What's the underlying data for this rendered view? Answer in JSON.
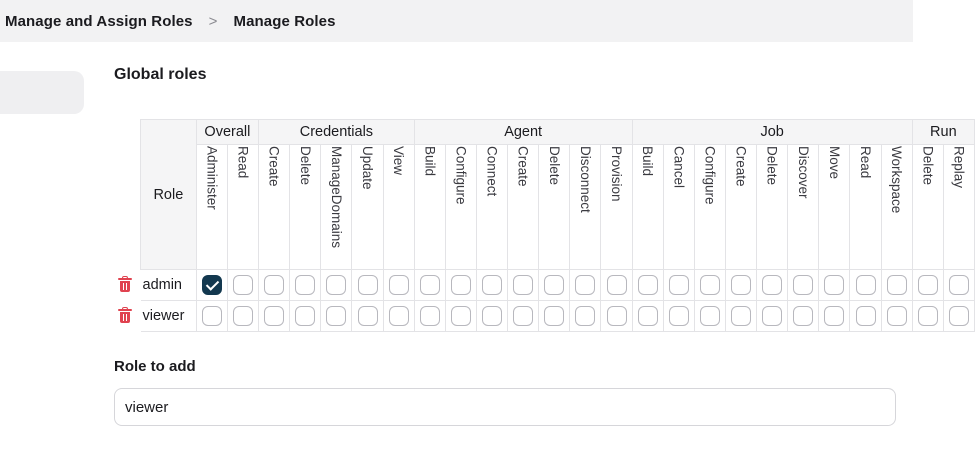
{
  "breadcrumb": {
    "items": [
      "Manage and Assign Roles",
      "Manage Roles"
    ],
    "separator": ">"
  },
  "global_roles": {
    "title": "Global roles",
    "role_header": "Role",
    "groups": [
      {
        "label": "Overall",
        "span": 2
      },
      {
        "label": "Credentials",
        "span": 5
      },
      {
        "label": "Agent",
        "span": 7
      },
      {
        "label": "Job",
        "span": 9
      },
      {
        "label": "Run",
        "span": 2
      }
    ],
    "permissions": [
      "Administer",
      "Read",
      "Create",
      "Delete",
      "ManageDomains",
      "Update",
      "View",
      "Build",
      "Configure",
      "Connect",
      "Create",
      "Delete",
      "Disconnect",
      "Provision",
      "Build",
      "Cancel",
      "Configure",
      "Create",
      "Delete",
      "Discover",
      "Move",
      "Read",
      "Workspace",
      "Delete",
      "Replay"
    ],
    "roles": [
      {
        "name": "admin",
        "checked": [
          0
        ]
      },
      {
        "name": "viewer",
        "checked": []
      }
    ],
    "colors": {
      "checked": "#13384f",
      "delete_icon": "#e0424f"
    }
  },
  "role_to_add": {
    "label": "Role to add",
    "value": "viewer"
  }
}
